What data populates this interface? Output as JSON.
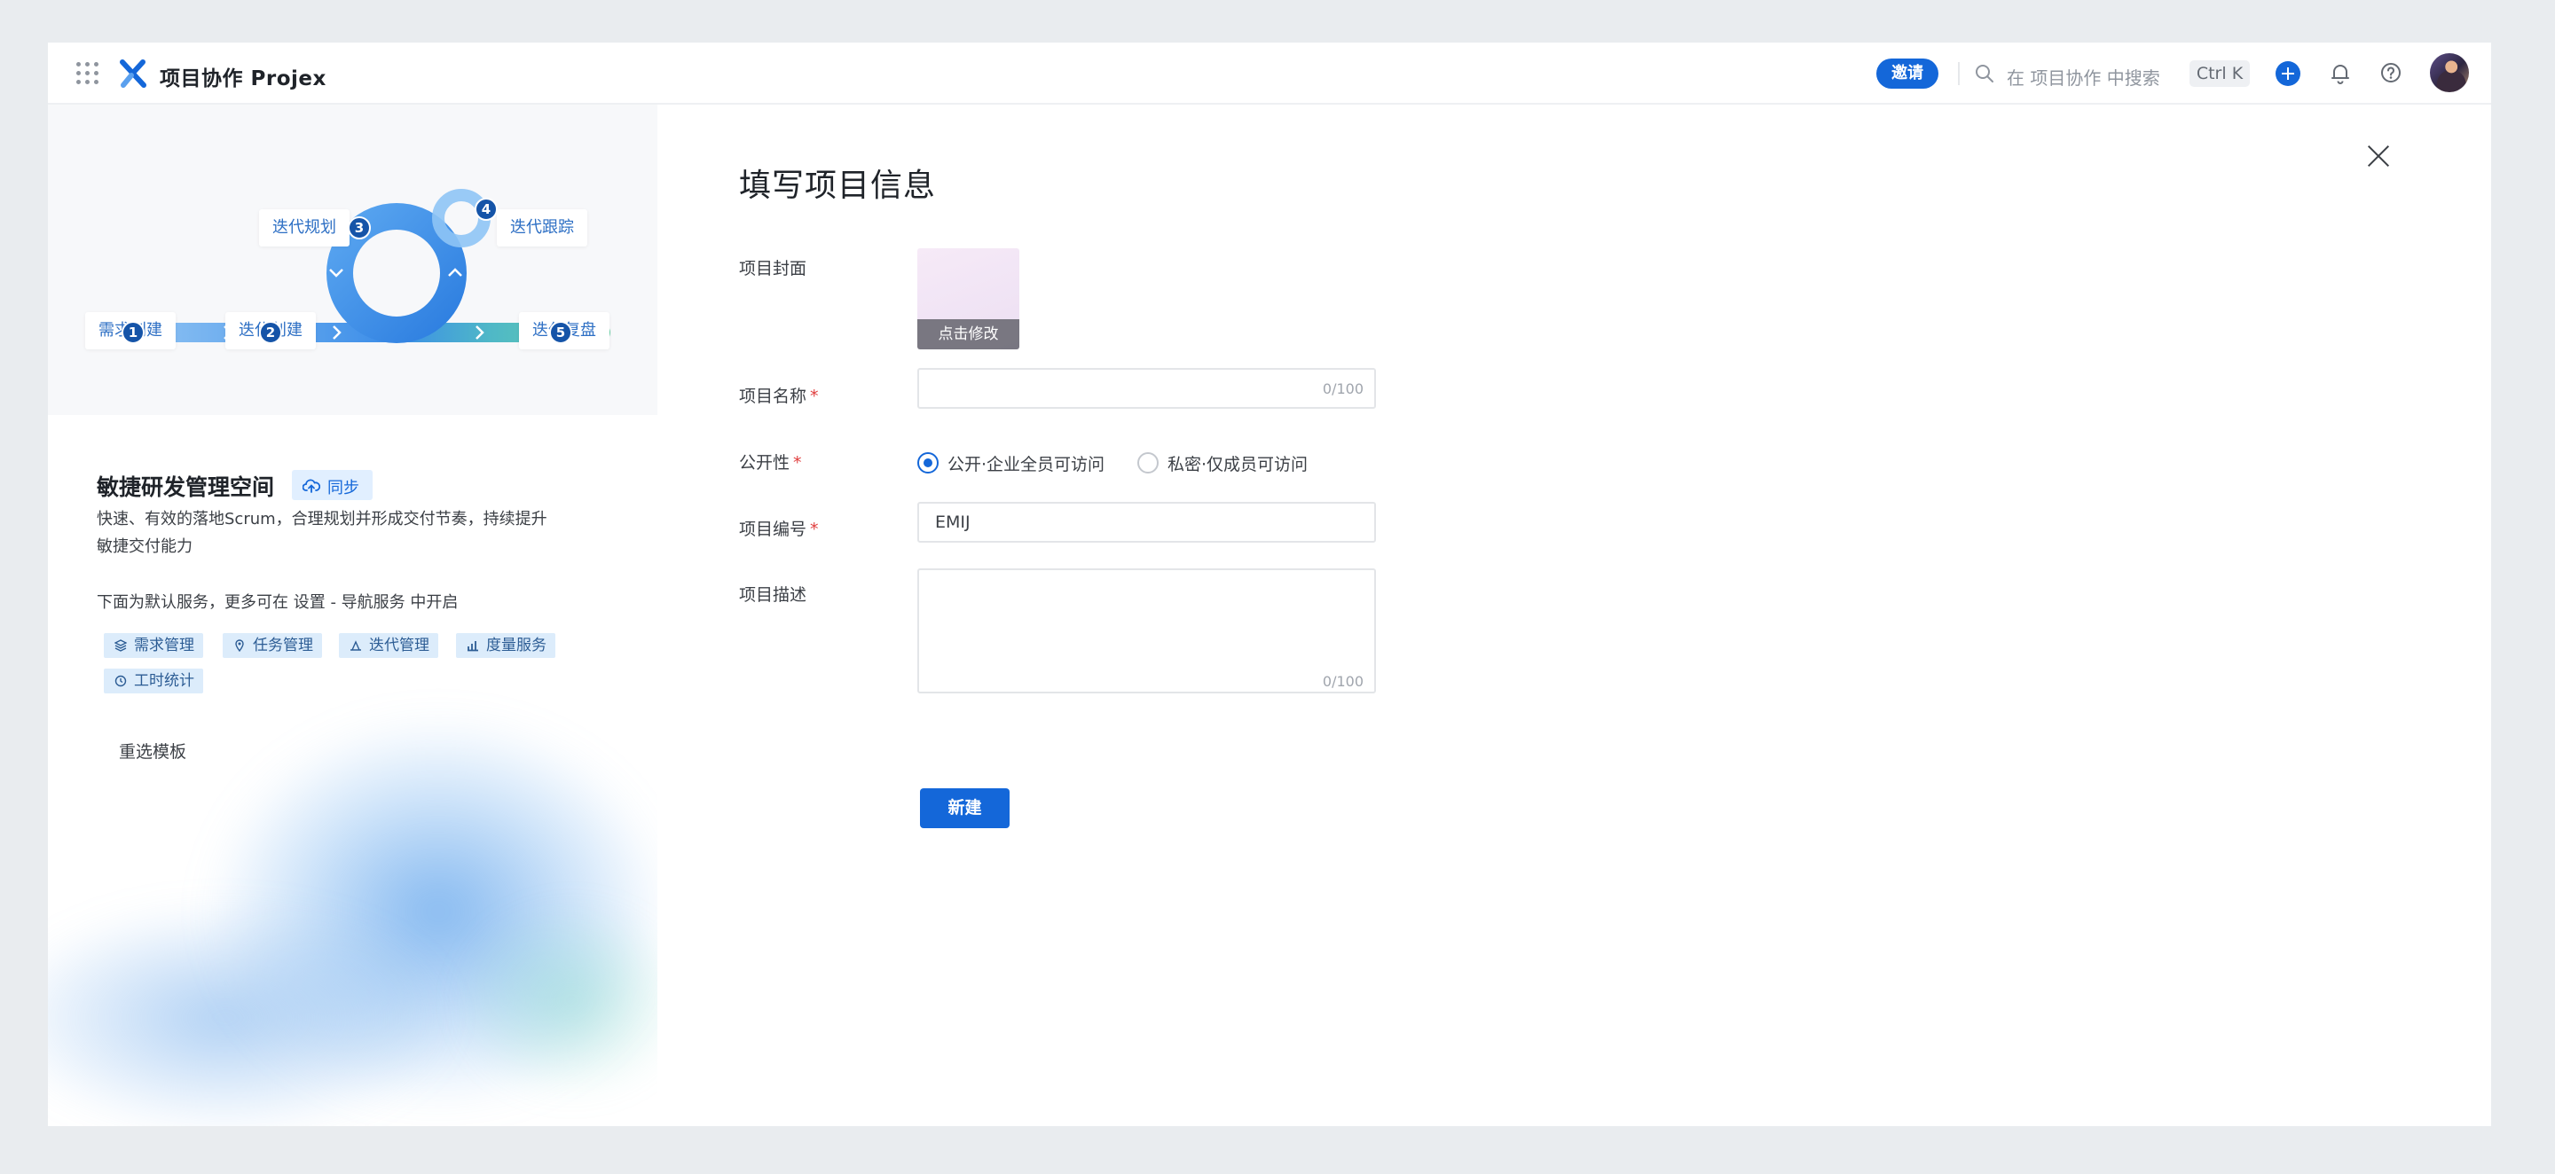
{
  "header": {
    "app_title": "项目协作 Projex",
    "invite_label": "邀请",
    "search_placeholder": "在 项目协作 中搜索",
    "shortcut": "Ctrl K",
    "icons": [
      "grid-icon",
      "projex-logo-icon",
      "search-icon",
      "plus-icon",
      "bell-icon",
      "help-icon"
    ]
  },
  "template": {
    "diagram": {
      "steps": [
        {
          "label": "需求创建",
          "num": "1"
        },
        {
          "label": "迭代创建",
          "num": "2"
        },
        {
          "label": "迭代规划",
          "num": "3"
        },
        {
          "label": "迭代跟踪",
          "num": "4"
        },
        {
          "label": "迭代复盘",
          "num": "5"
        }
      ]
    },
    "title": "敏捷研发管理空间",
    "sync_label": "同步",
    "description": "快速、有效的落地Scrum，合理规划并形成交付节奏，持续提升敏捷交付能力",
    "service_note": "下面为默认服务，更多可在 设置 - 导航服务 中开启",
    "services": [
      "需求管理",
      "任务管理",
      "迭代管理",
      "度量服务",
      "工时统计"
    ],
    "reselect_label": "重选模板"
  },
  "form": {
    "title": "填写项目信息",
    "cover_label": "项目封面",
    "cover_action": "点击修改",
    "name_label": "项目名称",
    "name_value": "",
    "name_counter": "0/100",
    "visibility_label": "公开性",
    "visibility_options": [
      "公开·企业全员可访问",
      "私密·仅成员可访问"
    ],
    "visibility_selected": "公开·企业全员可访问",
    "code_label": "项目编号",
    "code_value": "EMIJ",
    "desc_label": "项目描述",
    "desc_value": "",
    "desc_counter": "0/100",
    "required_mark": "*",
    "submit_label": "新建"
  },
  "colors": {
    "primary": "#1467d9",
    "required": "#e03e3e",
    "tag_bg": "#dcecfb",
    "flow_green": "#5fcaa0"
  }
}
